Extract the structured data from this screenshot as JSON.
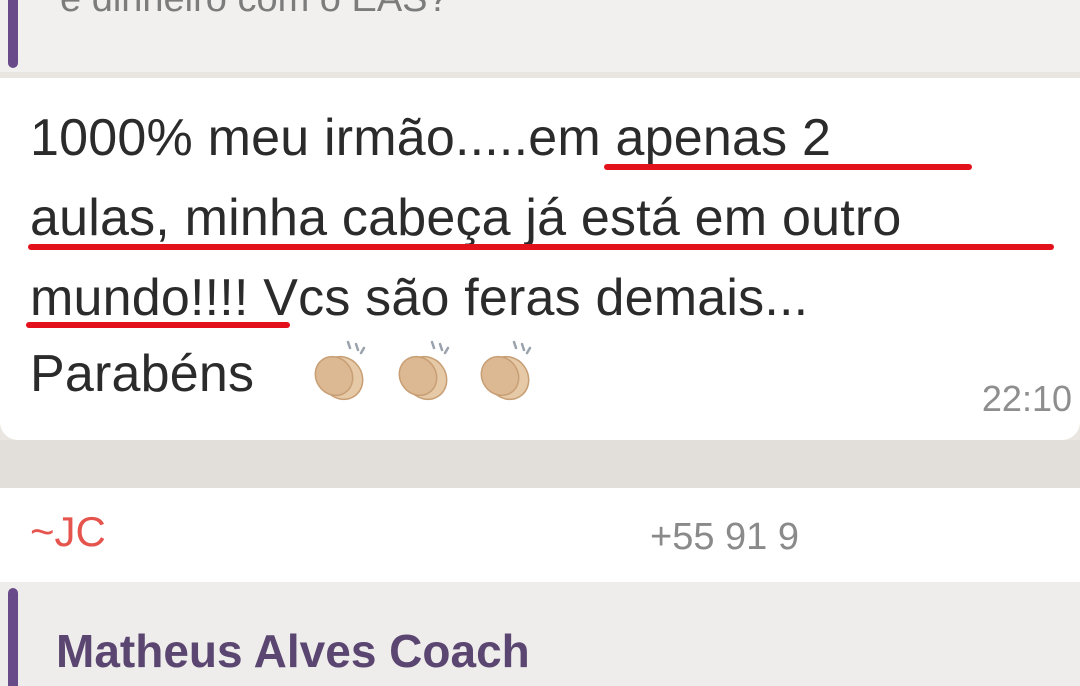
{
  "quoted_message": {
    "text": "e dinheiro com o EAS?"
  },
  "message": {
    "lines": [
      "1000% meu irmão.....em apenas 2",
      "aulas, minha cabeça já está em outro",
      "mundo!!!! Vcs são feras demais...",
      "Parabéns"
    ],
    "reaction_icons": [
      "clapping-hands-icon",
      "clapping-hands-icon",
      "clapping-hands-icon"
    ],
    "time": "22:10"
  },
  "next_message": {
    "sender": "~JC",
    "phone": "+55 91 9",
    "quoted_author": "Matheus Alves Coach"
  },
  "colors": {
    "underline": "#e3111b",
    "sender": "#e5544d",
    "quote_bar": "#6a4b8a"
  }
}
